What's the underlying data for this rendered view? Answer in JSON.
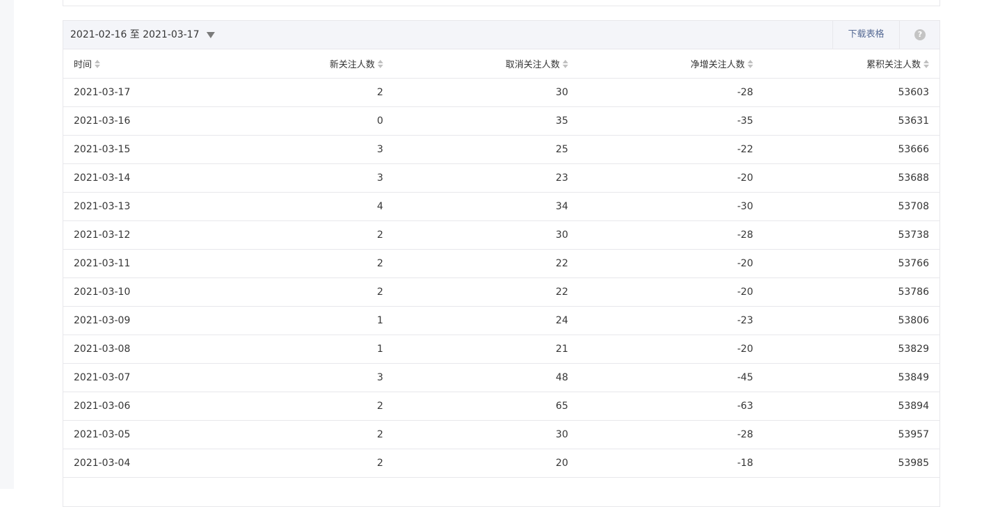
{
  "toolbar": {
    "date_range": "2021-02-16 至 2021-03-17",
    "download_label": "下载表格",
    "help_glyph": "?"
  },
  "colors": {
    "link": "#576b95",
    "header_bg": "#f4f5f9",
    "border": "#e7e7eb"
  },
  "table": {
    "columns": [
      "时间",
      "新关注人数",
      "取消关注人数",
      "净增关注人数",
      "累积关注人数"
    ],
    "rows": [
      [
        "2021-03-17",
        "2",
        "30",
        "-28",
        "53603"
      ],
      [
        "2021-03-16",
        "0",
        "35",
        "-35",
        "53631"
      ],
      [
        "2021-03-15",
        "3",
        "25",
        "-22",
        "53666"
      ],
      [
        "2021-03-14",
        "3",
        "23",
        "-20",
        "53688"
      ],
      [
        "2021-03-13",
        "4",
        "34",
        "-30",
        "53708"
      ],
      [
        "2021-03-12",
        "2",
        "30",
        "-28",
        "53738"
      ],
      [
        "2021-03-11",
        "2",
        "22",
        "-20",
        "53766"
      ],
      [
        "2021-03-10",
        "2",
        "22",
        "-20",
        "53786"
      ],
      [
        "2021-03-09",
        "1",
        "24",
        "-23",
        "53806"
      ],
      [
        "2021-03-08",
        "1",
        "21",
        "-20",
        "53829"
      ],
      [
        "2021-03-07",
        "3",
        "48",
        "-45",
        "53849"
      ],
      [
        "2021-03-06",
        "2",
        "65",
        "-63",
        "53894"
      ],
      [
        "2021-03-05",
        "2",
        "30",
        "-28",
        "53957"
      ],
      [
        "2021-03-04",
        "2",
        "20",
        "-18",
        "53985"
      ]
    ]
  }
}
